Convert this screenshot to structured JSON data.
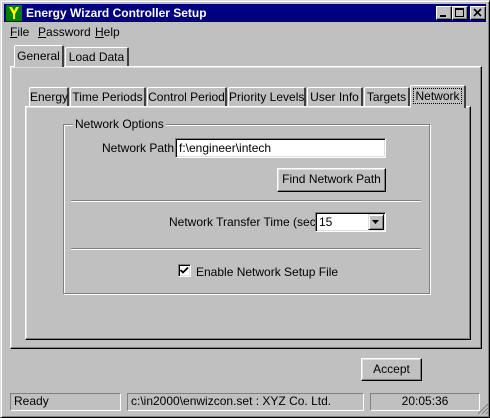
{
  "window": {
    "title": "Energy Wizard Controller Setup",
    "icon": "energy-wizard-app-icon"
  },
  "menu": {
    "file": {
      "accel": "F",
      "rest": "ile"
    },
    "password": {
      "accel": "P",
      "rest": "assword"
    },
    "help": {
      "accel": "H",
      "rest": "elp"
    }
  },
  "outer_tabs": [
    "General",
    "Load Data"
  ],
  "inner_tabs": [
    "Energy",
    "Time Periods",
    "Control Period",
    "Priority Levels",
    "User Info",
    "Targets",
    "Network"
  ],
  "active_inner_tab": "Network",
  "network_options": {
    "group_label": "Network Options",
    "path_label": "Network Path:",
    "path_value": "f:\\engineer\\intech",
    "find_button": "Find Network Path",
    "transfer_label": "Network Transfer Time (secs):",
    "transfer_value": "15",
    "enable_label": "Enable Network Setup File",
    "enable_checked": true
  },
  "accept_button": "Accept",
  "status": {
    "state": "Ready",
    "file": "c:\\in2000\\enwizcon.set : XYZ Co. Ltd.",
    "time": "20:05:36"
  },
  "colors": {
    "titlebar": "#000080",
    "face": "#c0c0c0"
  }
}
